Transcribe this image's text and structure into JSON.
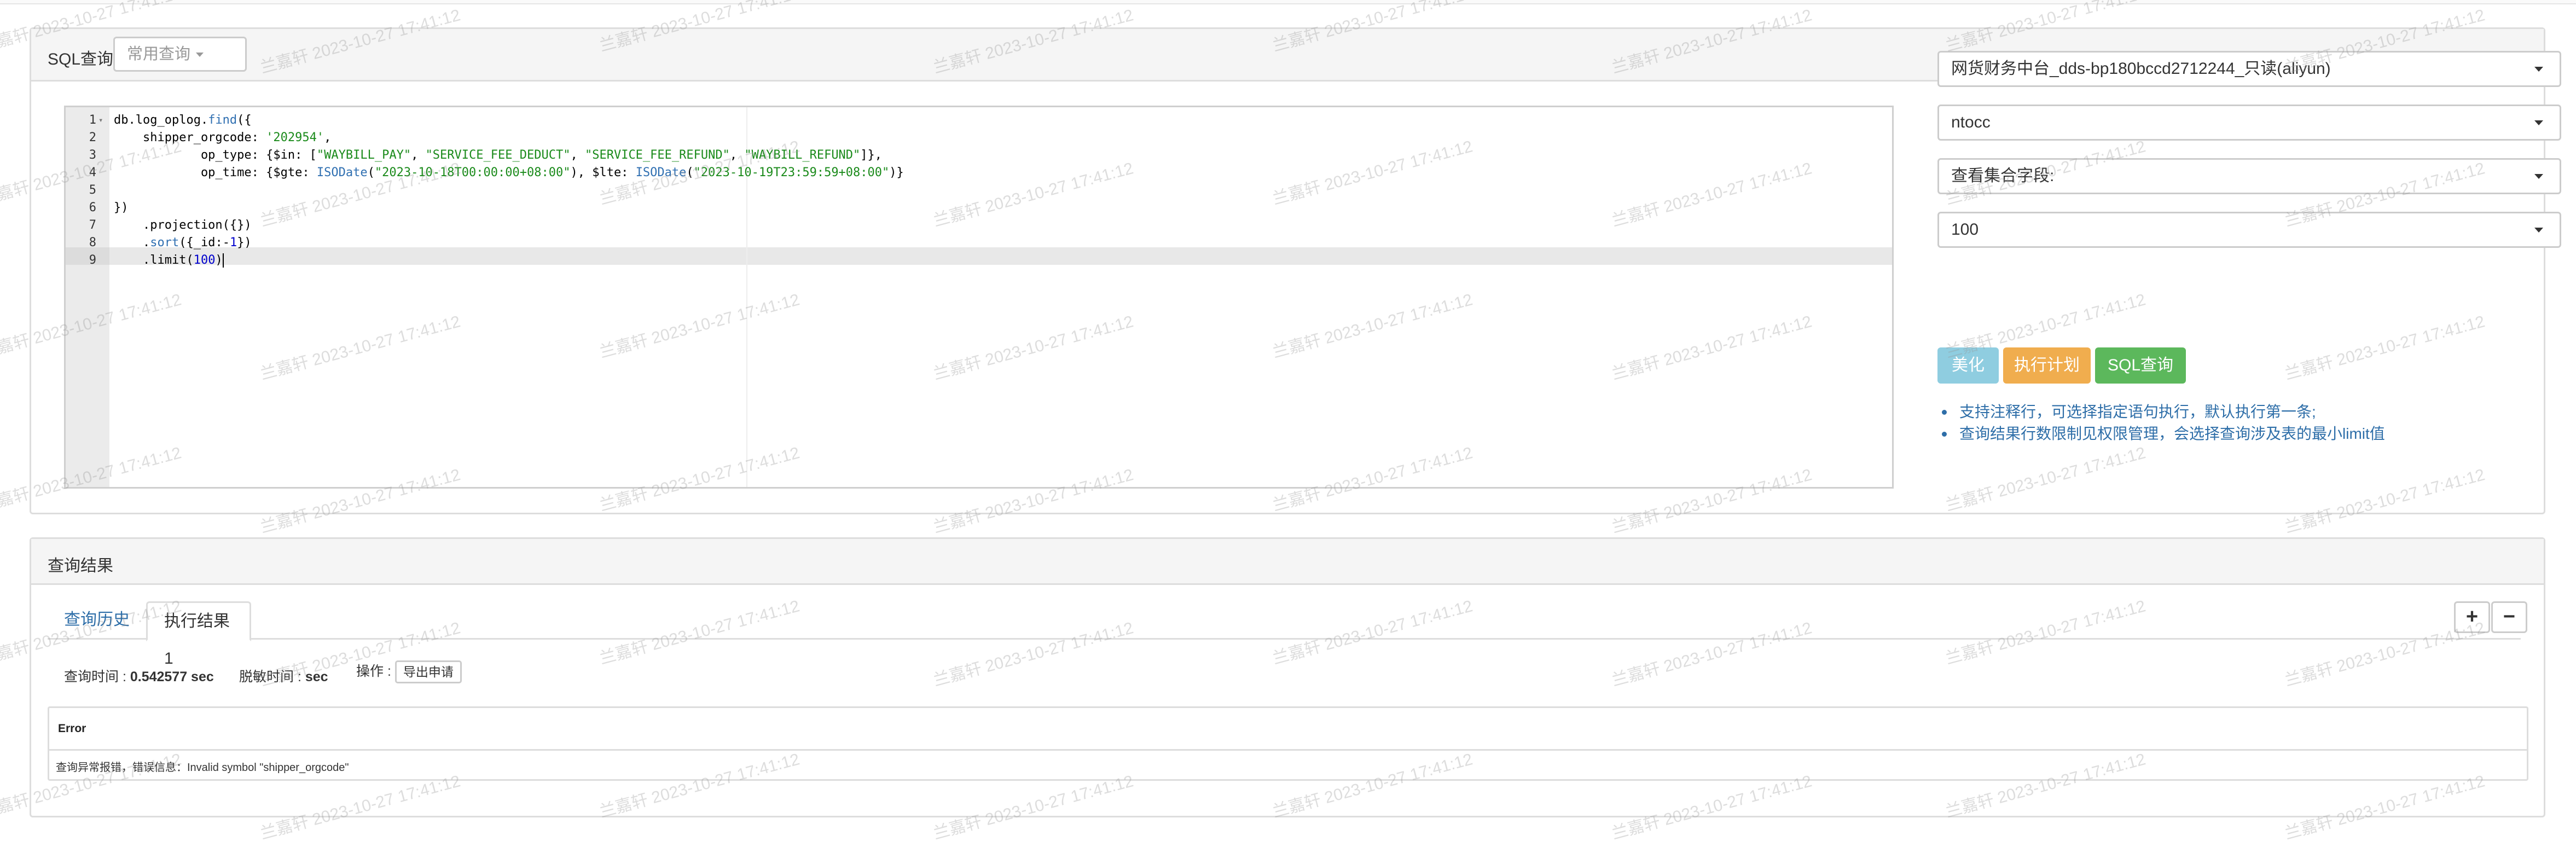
{
  "sql_panel": {
    "title": "SQL查询",
    "common_query_label": "常用查询",
    "editor": {
      "lines": [
        {
          "num": "1",
          "parts": [
            [
              "t",
              "db.log_oplog."
            ],
            [
              "f",
              "find"
            ],
            [
              "t",
              "({"
            ]
          ]
        },
        {
          "num": "2",
          "parts": [
            [
              "t",
              "    shipper_orgcode: "
            ],
            [
              "s",
              "'202954'"
            ],
            [
              "t",
              ","
            ]
          ]
        },
        {
          "num": "3",
          "parts": [
            [
              "t",
              "            op_type: {$in: ["
            ],
            [
              "s",
              "\"WAYBILL_PAY\""
            ],
            [
              "t",
              ", "
            ],
            [
              "s",
              "\"SERVICE_FEE_DEDUCT\""
            ],
            [
              "t",
              ", "
            ],
            [
              "s",
              "\"SERVICE_FEE_REFUND\""
            ],
            [
              "t",
              ", "
            ],
            [
              "s",
              "\"WAYBILL_REFUND\""
            ],
            [
              "t",
              "]},"
            ]
          ]
        },
        {
          "num": "4",
          "parts": [
            [
              "t",
              "            op_time: {$gte: "
            ],
            [
              "f",
              "ISODate"
            ],
            [
              "t",
              "("
            ],
            [
              "s",
              "\"2023-10-18T00:00:00+08:00\""
            ],
            [
              "t",
              "), $lte: "
            ],
            [
              "f",
              "ISODate"
            ],
            [
              "t",
              "("
            ],
            [
              "s",
              "\"2023-10-19T23:59:59+08:00\""
            ],
            [
              "t",
              ")}"
            ]
          ]
        },
        {
          "num": "5",
          "parts": [
            [
              "t",
              ""
            ]
          ]
        },
        {
          "num": "6",
          "parts": [
            [
              "t",
              "})"
            ]
          ]
        },
        {
          "num": "7",
          "parts": [
            [
              "t",
              "    .projection({})"
            ]
          ]
        },
        {
          "num": "8",
          "parts": [
            [
              "t",
              "    ."
            ],
            [
              "f",
              "sort"
            ],
            [
              "t",
              "({_id:-"
            ],
            [
              "n",
              "1"
            ],
            [
              "t",
              "})"
            ]
          ]
        },
        {
          "num": "9",
          "parts": [
            [
              "t",
              "    .limit("
            ],
            [
              "n",
              "100"
            ],
            [
              "t",
              ")"
            ]
          ]
        }
      ]
    },
    "instance_select": "网货财务中台_dds-bp180bccd2712244_只读(aliyun)",
    "db_select": "ntocc",
    "collection_fields_select": "查看集合字段:",
    "limit_select": "100",
    "buttons": {
      "beautify": "美化",
      "explain": "执行计划",
      "query": "SQL查询"
    },
    "tips": [
      "支持注释行，可选择指定语句执行，默认执行第一条;",
      "查询结果行数限制见权限管理，会选择查询涉及表的最小limit值"
    ]
  },
  "result_panel": {
    "title": "查询结果",
    "tabs": [
      "查询历史",
      "执行结果1"
    ],
    "plus_label": "+",
    "minus_label": "−",
    "query_time_label": "查询时间 : ",
    "query_time_value": "0.542577 sec",
    "desense_label": "脱敏时间 : ",
    "desense_value": "sec",
    "ops_label": "操作 : ",
    "export_label": "导出申请",
    "error_title": "Error",
    "error_message": "查询异常报错，错误信息：Invalid symbol \"shipper_orgcode\""
  },
  "watermark": "兰嘉轩 2023-10-27 17:41:12"
}
